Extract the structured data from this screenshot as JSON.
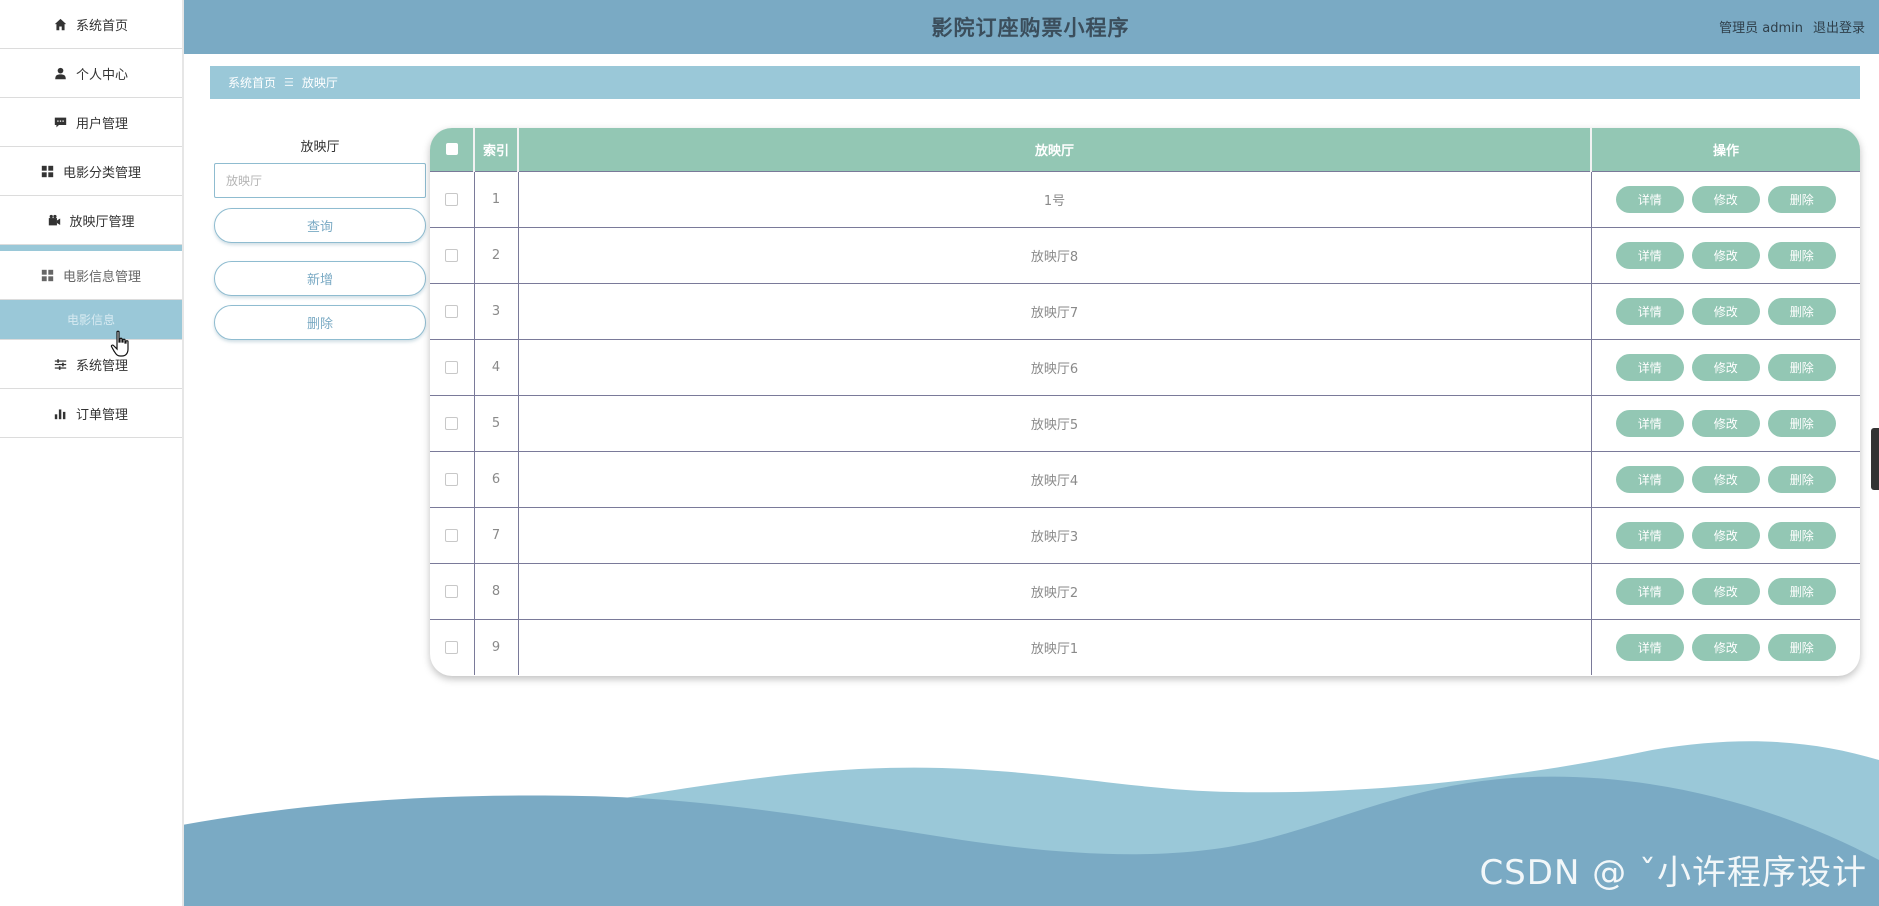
{
  "app": {
    "title": "影院订座购票小程序",
    "user_role": "管理员 admin",
    "logout": "退出登录"
  },
  "sidebar": {
    "items": [
      {
        "label": "系统首页",
        "icon": "home-icon"
      },
      {
        "label": "个人中心",
        "icon": "user-icon"
      },
      {
        "label": "用户管理",
        "icon": "chat-icon"
      },
      {
        "label": "电影分类管理",
        "icon": "grid-icon"
      },
      {
        "label": "放映厅管理",
        "icon": "video-icon"
      },
      {
        "label": "电影信息管理",
        "icon": "grid-icon"
      },
      {
        "label": "系统管理",
        "icon": "sliders-icon"
      },
      {
        "label": "订单管理",
        "icon": "bar-chart-icon"
      }
    ],
    "submenu": {
      "label": "电影信息"
    }
  },
  "breadcrumb": {
    "home": "系统首页",
    "separator": "☰",
    "current": "放映厅"
  },
  "search": {
    "label": "放映厅",
    "placeholder": "放映厅",
    "query_button": "查询",
    "add_button": "新增",
    "delete_button": "删除"
  },
  "table": {
    "headers": {
      "index": "索引",
      "hall": "放映厅",
      "actions": "操作"
    },
    "rows": [
      {
        "index": "1",
        "hall": "1号"
      },
      {
        "index": "2",
        "hall": "放映厅8"
      },
      {
        "index": "3",
        "hall": "放映厅7"
      },
      {
        "index": "4",
        "hall": "放映厅6"
      },
      {
        "index": "5",
        "hall": "放映厅5"
      },
      {
        "index": "6",
        "hall": "放映厅4"
      },
      {
        "index": "7",
        "hall": "放映厅3"
      },
      {
        "index": "8",
        "hall": "放映厅2"
      },
      {
        "index": "9",
        "hall": "放映厅1"
      }
    ],
    "actions": {
      "detail": "详情",
      "edit": "修改",
      "delete": "删除"
    }
  },
  "watermark": "CSDN @ ˇ小许程序设计",
  "colors": {
    "header": "#7aaac4",
    "breadcrumb": "#9ac8d8",
    "table_header": "#93c7b4",
    "button": "#93c7b4",
    "wave_back": "#9ac8d8",
    "wave_front": "#7aaac4"
  }
}
